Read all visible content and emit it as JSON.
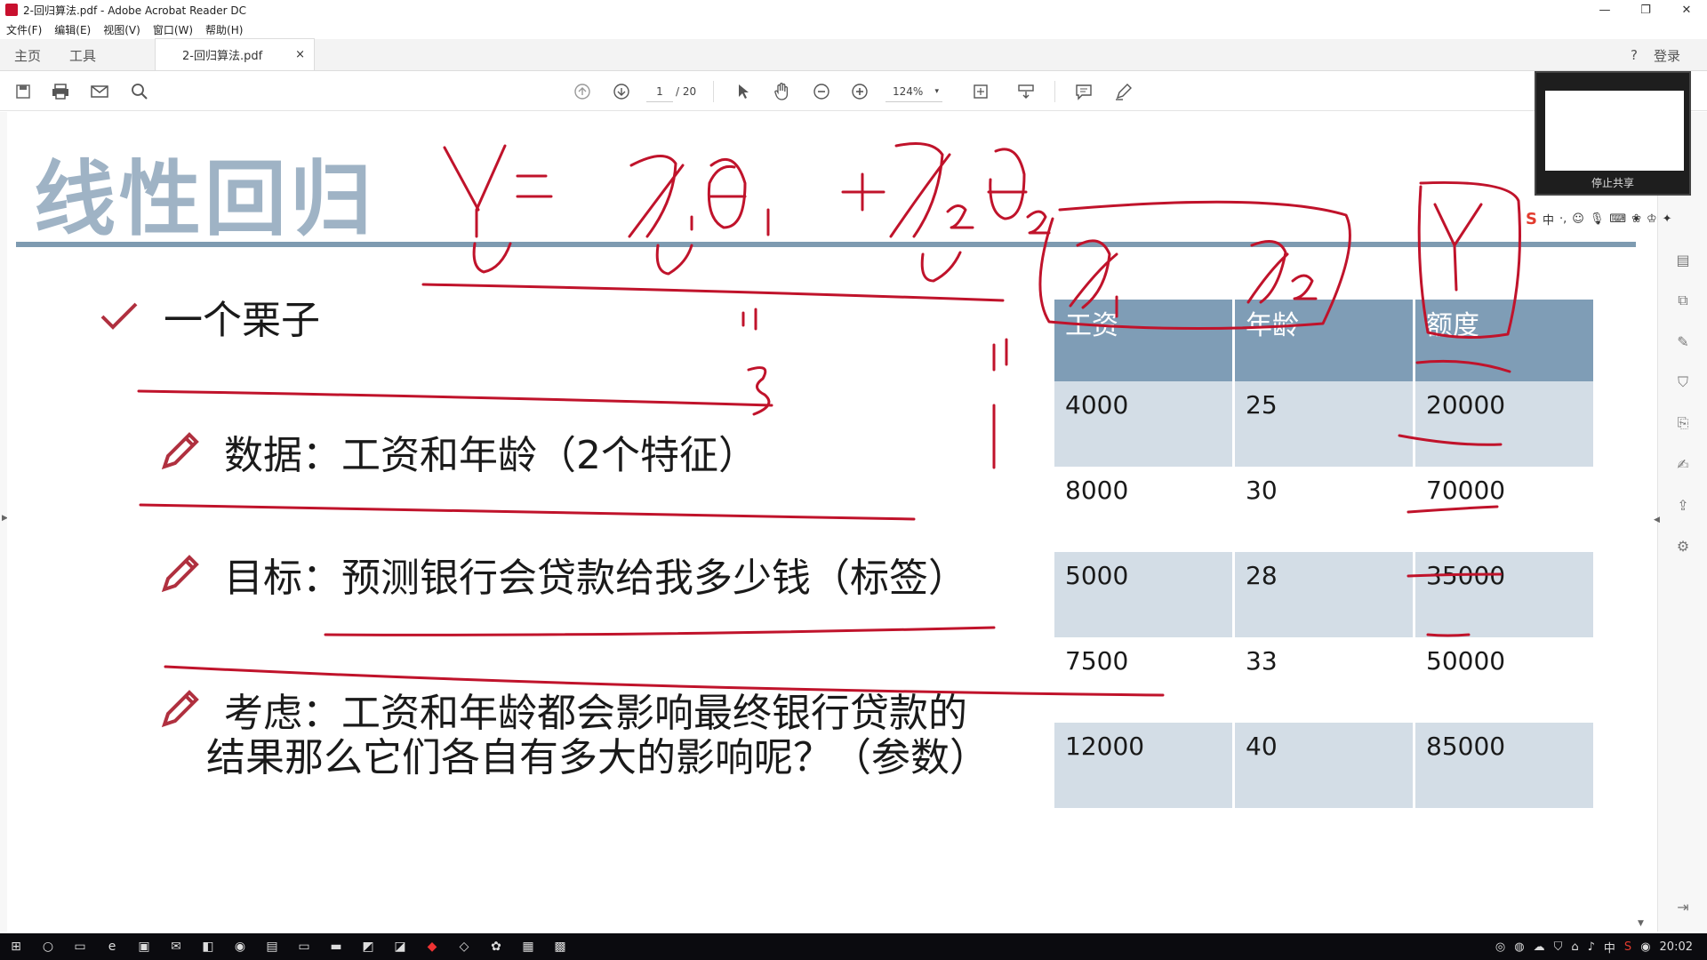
{
  "window": {
    "title": "2-回归算法.pdf - Adobe Acrobat Reader DC"
  },
  "menu": [
    "文件(F)",
    "编辑(E)",
    "视图(V)",
    "窗口(W)",
    "帮助(H)"
  ],
  "tabs": {
    "home": "主页",
    "tools": "工具",
    "doc": "2-回归算法.pdf",
    "close": "×",
    "login": "登录"
  },
  "toolbar": {
    "page_current": "1",
    "page_total": "/ 20",
    "zoom": "124%"
  },
  "slide": {
    "title": "线性回归",
    "bullets": [
      {
        "text": "一个栗子"
      },
      {
        "text": "数据：工资和年龄（2个特征）"
      },
      {
        "text": "目标：预测银行会贷款给我多少钱（标签）"
      },
      {
        "text": "考虑：工资和年龄都会影响最终银行贷款的"
      }
    ],
    "bullet4_line2": "结果那么它们各自有多大的影响呢？（参数）"
  },
  "table": {
    "headers": [
      "工资",
      "年龄",
      "额度"
    ],
    "rows": [
      [
        "4000",
        "25",
        "20000"
      ],
      [
        "8000",
        "30",
        "70000"
      ],
      [
        "5000",
        "28",
        "35000"
      ],
      [
        "7500",
        "33",
        "50000"
      ],
      [
        "12000",
        "40",
        "85000"
      ]
    ]
  },
  "share": {
    "stop_label": "停止共享"
  },
  "ime": {
    "lang": "中"
  },
  "clock": {
    "time": "20:02"
  },
  "colors": {
    "slide_title": "#9fb3c5",
    "rule": "#7e9bb1",
    "table_header": "#7f9db6",
    "table_shade": "#d3dde6",
    "ink": "#c0132b"
  }
}
